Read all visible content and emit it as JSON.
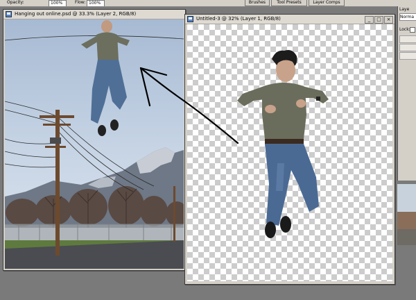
{
  "options_bar": {
    "opacity_label": "Opacity:",
    "opacity_value": "100%",
    "flow_label": "Flow:",
    "flow_value": "100%"
  },
  "panel_tabs": [
    "Brushes",
    "Tool Presets",
    "Layer Comps"
  ],
  "doc1": {
    "title": "Hanging out online.psd @ 33.3% (Layer 2, RGB/8)"
  },
  "doc2": {
    "title": "Untitled-3 @ 32% (Layer 1, RGB/8)"
  },
  "layers_panel": {
    "title": "Laye",
    "blend_mode": "Norma",
    "lock_label": "Lock:"
  },
  "icons": [
    "document-icon",
    "minimize-icon",
    "maximize-icon",
    "close-icon"
  ],
  "colors": {
    "ui_gray": "#d4d0c8",
    "workspace": "#7a7a7a",
    "sky": "#b9cbdf",
    "arrow": "#000000"
  }
}
